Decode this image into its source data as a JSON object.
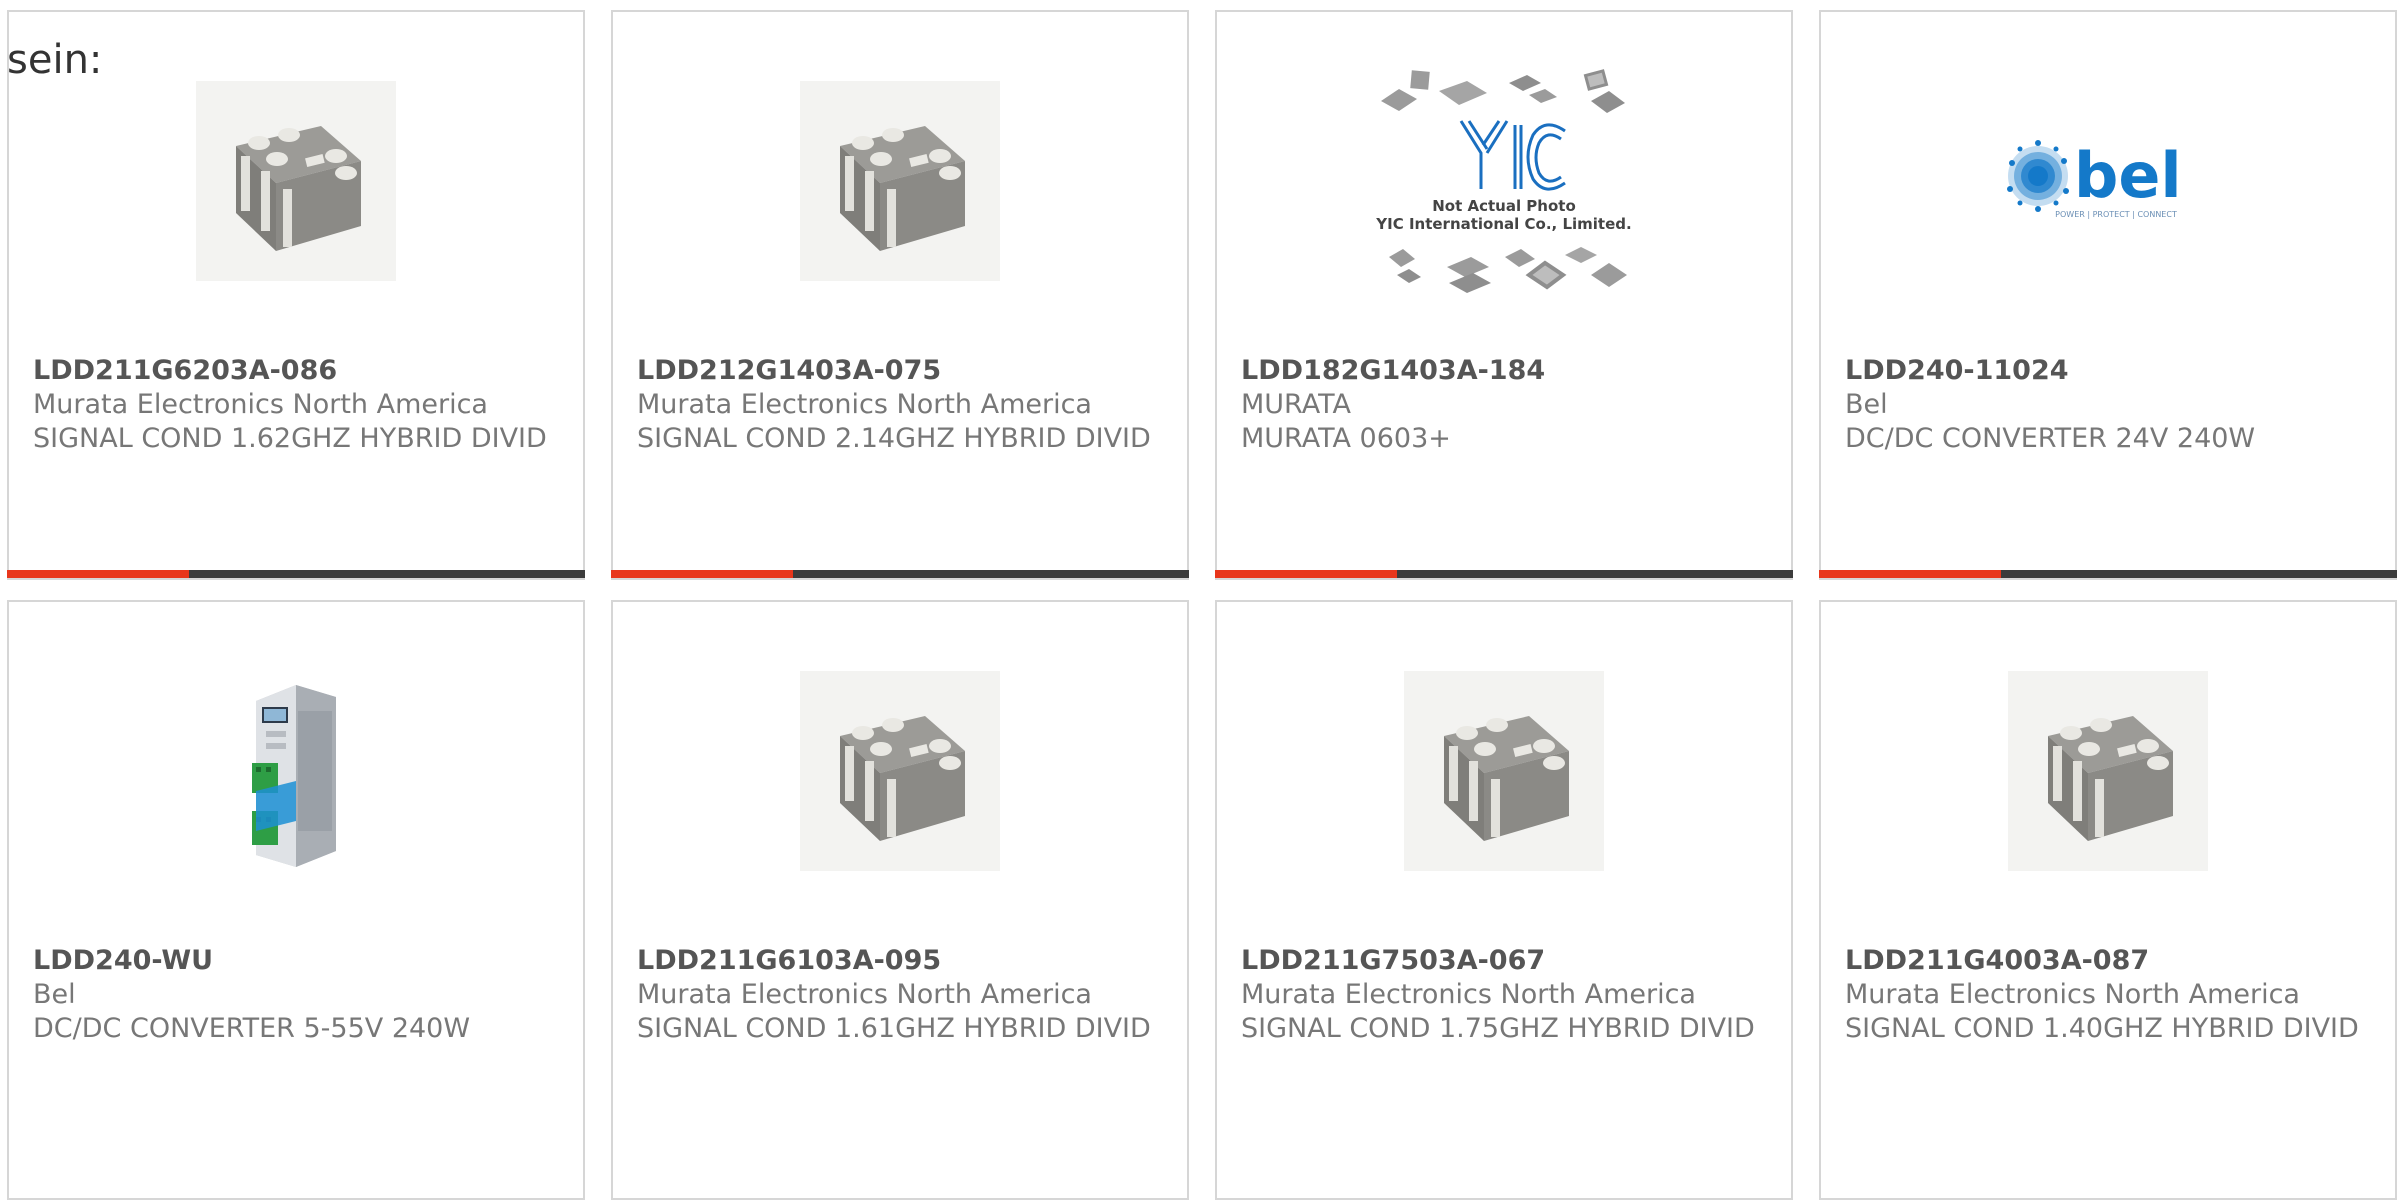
{
  "heading": "sein:",
  "products": [
    {
      "part": "LDD211G6203A-086",
      "manufacturer": "Murata Electronics North America",
      "description": "SIGNAL COND 1.62GHZ HYBRID DIVID",
      "image": "chip-component"
    },
    {
      "part": "LDD212G1403A-075",
      "manufacturer": "Murata Electronics North America",
      "description": "SIGNAL COND 2.14GHZ HYBRID DIVID",
      "image": "chip-component"
    },
    {
      "part": "LDD182G1403A-184",
      "manufacturer": "MURATA",
      "description": "MURATA 0603+",
      "image": "yic-placeholder",
      "image_text": {
        "logo": "YIC",
        "line1": "Not Actual Photo",
        "line2": "YIC International Co., Limited."
      }
    },
    {
      "part": "LDD240-11024",
      "manufacturer": "Bel",
      "description": "DC/DC CONVERTER 24V 240W",
      "image": "bel-logo",
      "image_text": {
        "logo": "bel",
        "tagline": "POWER | PROTECT | CONNECT"
      }
    },
    {
      "part": "LDD240-WU",
      "manufacturer": "Bel",
      "description": "DC/DC CONVERTER 5-55V 240W",
      "image": "din-rail-module"
    },
    {
      "part": "LDD211G6103A-095",
      "manufacturer": "Murata Electronics North America",
      "description": "SIGNAL COND 1.61GHZ HYBRID DIVID",
      "image": "chip-component"
    },
    {
      "part": "LDD211G7503A-067",
      "manufacturer": "Murata Electronics North America",
      "description": "SIGNAL COND 1.75GHZ HYBRID DIVID",
      "image": "chip-component"
    },
    {
      "part": "LDD211G4003A-087",
      "manufacturer": "Murata Electronics North America",
      "description": "SIGNAL COND 1.40GHZ HYBRID DIVID",
      "image": "chip-component"
    }
  ],
  "colors": {
    "accent": "#e8361b",
    "bar_dark": "#3b3b3b",
    "card_border": "#d6d6d6",
    "bel_blue": "#1479c9",
    "yic_blue": "#1a6fc0"
  }
}
